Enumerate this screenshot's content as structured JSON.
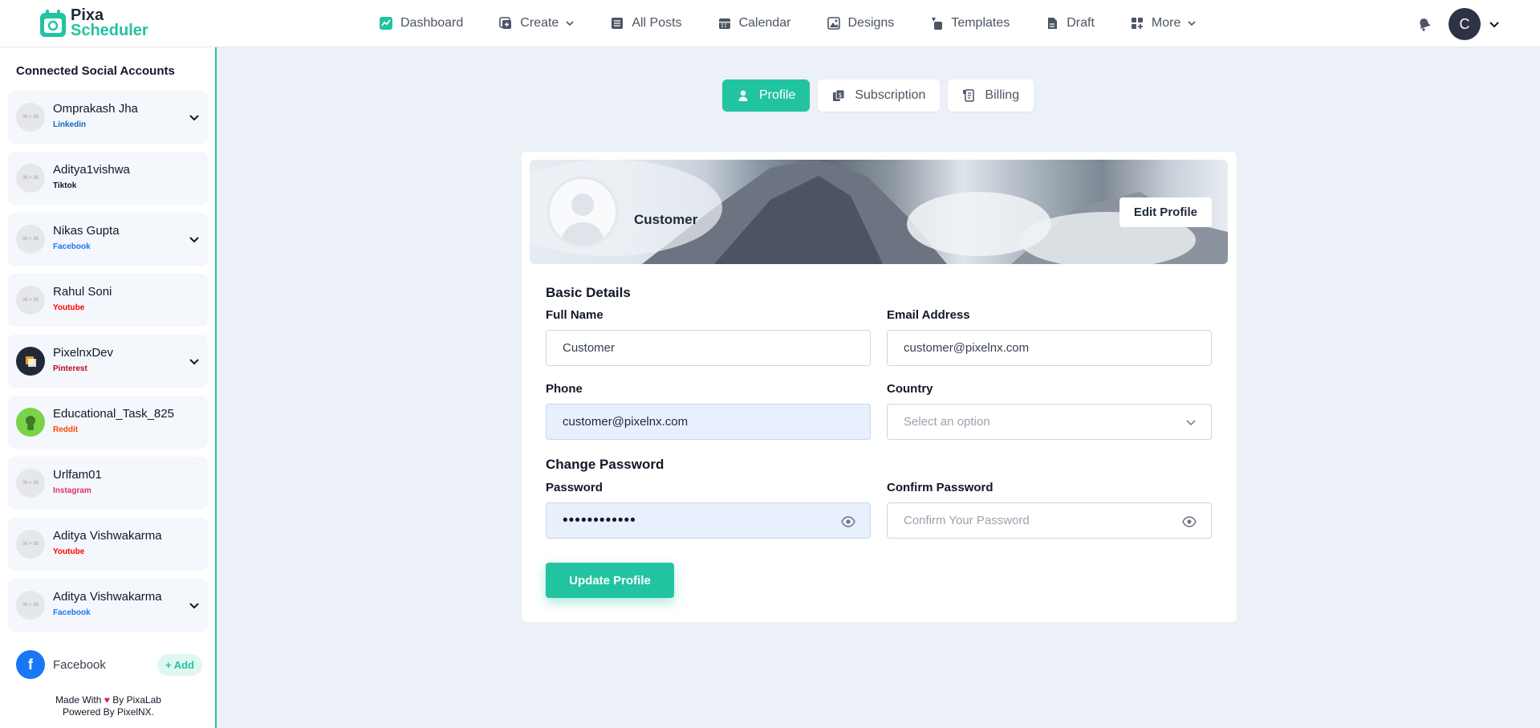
{
  "app": {
    "logo_line1": "Pixa",
    "logo_line2": "Scheduler",
    "accent": "#22c3a0"
  },
  "nav": {
    "items": [
      {
        "label": "Dashboard",
        "icon": "chart-icon"
      },
      {
        "label": "Create",
        "icon": "plus-square-icon",
        "dropdown": true
      },
      {
        "label": "All Posts",
        "icon": "list-icon"
      },
      {
        "label": "Calendar",
        "icon": "calendar-icon"
      },
      {
        "label": "Designs",
        "icon": "image-icon"
      },
      {
        "label": "Templates",
        "icon": "shapes-icon"
      },
      {
        "label": "Draft",
        "icon": "file-icon"
      },
      {
        "label": "More",
        "icon": "grid-icon",
        "dropdown": true
      }
    ],
    "avatar_initial": "C"
  },
  "sidebar": {
    "title": "Connected Social Accounts",
    "avatar_placeholder": "36 × 36",
    "accounts": [
      {
        "name": "Omprakash Jha",
        "platform": "Linkedin",
        "color": "#0a66c2",
        "expandable": true
      },
      {
        "name": "Aditya1vishwa",
        "platform": "Tiktok",
        "color": "#111827",
        "expandable": false
      },
      {
        "name": "Nikas Gupta",
        "platform": "Facebook",
        "color": "#1877f2",
        "expandable": true
      },
      {
        "name": "Rahul Soni",
        "platform": "Youtube",
        "color": "#ff0000",
        "expandable": false
      },
      {
        "name": "PixelnxDev",
        "platform": "Pinterest",
        "color": "#bd081c",
        "expandable": true
      },
      {
        "name": "Educational_Task_825",
        "platform": "Reddit",
        "color": "#ff4500",
        "expandable": false
      },
      {
        "name": "Urlfam01",
        "platform": "Instagram",
        "color": "#e1306c",
        "expandable": false
      },
      {
        "name": "Aditya Vishwakarma",
        "platform": "Youtube",
        "color": "#ff0000",
        "expandable": false
      },
      {
        "name": "Aditya Vishwakarma",
        "platform": "Facebook",
        "color": "#1877f2",
        "expandable": true
      }
    ],
    "add_platform": {
      "label": "Facebook",
      "button": "Add"
    },
    "footer_line1_pre": "Made With",
    "footer_line1_post": "By PixaLab",
    "footer_line2": "Powered By PixelNX."
  },
  "tabs": [
    {
      "label": "Profile",
      "active": true
    },
    {
      "label": "Subscription",
      "active": false
    },
    {
      "label": "Billing",
      "active": false
    }
  ],
  "profile": {
    "name": "Customer",
    "edit_button": "Edit Profile",
    "basic_details_title": "Basic Details",
    "full_name_label": "Full Name",
    "full_name_value": "Customer",
    "email_label": "Email Address",
    "email_value": "customer@pixelnx.com",
    "phone_label": "Phone",
    "phone_value": "customer@pixelnx.com",
    "country_label": "Country",
    "country_placeholder": "Select an option",
    "change_password_title": "Change Password",
    "password_label": "Password",
    "password_value": "••••••••••••",
    "confirm_password_label": "Confirm Password",
    "confirm_password_placeholder": "Confirm Your Password",
    "update_button": "Update Profile"
  }
}
